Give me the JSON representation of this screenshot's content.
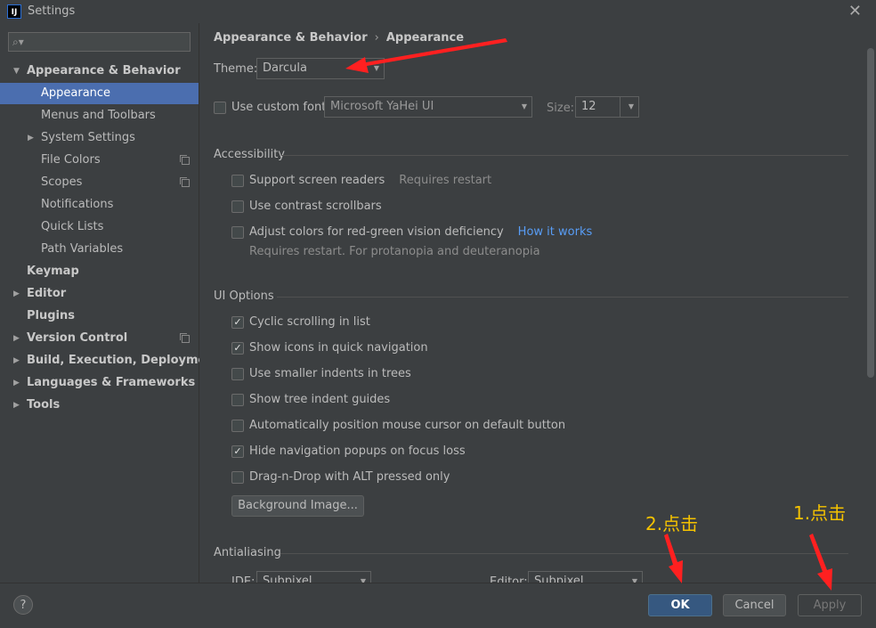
{
  "window": {
    "title": "Settings",
    "app_icon": "IJ"
  },
  "sidebar": {
    "search_placeholder": "",
    "items": [
      {
        "label": "Appearance & Behavior",
        "level": 0,
        "expanded": true,
        "bold": true
      },
      {
        "label": "Appearance",
        "level": 1,
        "selected": true
      },
      {
        "label": "Menus and Toolbars",
        "level": 1
      },
      {
        "label": "System Settings",
        "level": 1,
        "collapsed": true
      },
      {
        "label": "File Colors",
        "level": 1,
        "project_icon": true
      },
      {
        "label": "Scopes",
        "level": 1,
        "project_icon": true
      },
      {
        "label": "Notifications",
        "level": 1
      },
      {
        "label": "Quick Lists",
        "level": 1
      },
      {
        "label": "Path Variables",
        "level": 1
      },
      {
        "label": "Keymap",
        "level": 0,
        "bold": true
      },
      {
        "label": "Editor",
        "level": 0,
        "bold": true,
        "collapsed": true
      },
      {
        "label": "Plugins",
        "level": 0,
        "bold": true
      },
      {
        "label": "Version Control",
        "level": 0,
        "bold": true,
        "collapsed": true,
        "project_icon": true
      },
      {
        "label": "Build, Execution, Deployment",
        "level": 0,
        "bold": true,
        "collapsed": true
      },
      {
        "label": "Languages & Frameworks",
        "level": 0,
        "bold": true,
        "collapsed": true
      },
      {
        "label": "Tools",
        "level": 0,
        "bold": true,
        "collapsed": true
      }
    ]
  },
  "breadcrumb": {
    "parent": "Appearance & Behavior",
    "sep": "›",
    "current": "Appearance"
  },
  "theme": {
    "label": "Theme:",
    "value": "Darcula"
  },
  "font": {
    "checkbox_label": "Use custom font:",
    "checked": false,
    "value": "Microsoft YaHei UI",
    "size_label": "Size:",
    "size_value": "12"
  },
  "accessibility": {
    "title": "Accessibility",
    "screen_readers": {
      "label": "Support screen readers",
      "hint": "Requires restart",
      "checked": false
    },
    "contrast_scrollbars": {
      "label": "Use contrast scrollbars",
      "checked": false
    },
    "adjust_colors": {
      "label": "Adjust colors for red-green vision deficiency",
      "link": "How it works",
      "hint": "Requires restart. For protanopia and deuteranopia",
      "checked": false
    }
  },
  "ui_options": {
    "title": "UI Options",
    "items": [
      {
        "label": "Cyclic scrolling in list",
        "checked": true
      },
      {
        "label": "Show icons in quick navigation",
        "checked": true
      },
      {
        "label": "Use smaller indents in trees",
        "checked": false
      },
      {
        "label": "Show tree indent guides",
        "checked": false
      },
      {
        "label": "Automatically position mouse cursor on default button",
        "checked": false
      },
      {
        "label": "Hide navigation popups on focus loss",
        "checked": true
      },
      {
        "label": "Drag-n-Drop with ALT pressed only",
        "checked": false
      }
    ],
    "background_button": "Background Image..."
  },
  "antialiasing": {
    "title": "Antialiasing",
    "ide_label": "IDE:",
    "ide_value": "Subpixel",
    "editor_label": "Editor:",
    "editor_value": "Subpixel"
  },
  "footer": {
    "help": "?",
    "ok": "OK",
    "cancel": "Cancel",
    "apply": "Apply"
  },
  "annotations": {
    "step2": "2.点击",
    "step1": "1.点击",
    "arrow_color": "#ff2020",
    "label_color": "#f5c200"
  },
  "colors": {
    "selection": "#4b6eaf",
    "background": "#3c3f41",
    "link": "#589df6",
    "ok_button": "#365880"
  }
}
